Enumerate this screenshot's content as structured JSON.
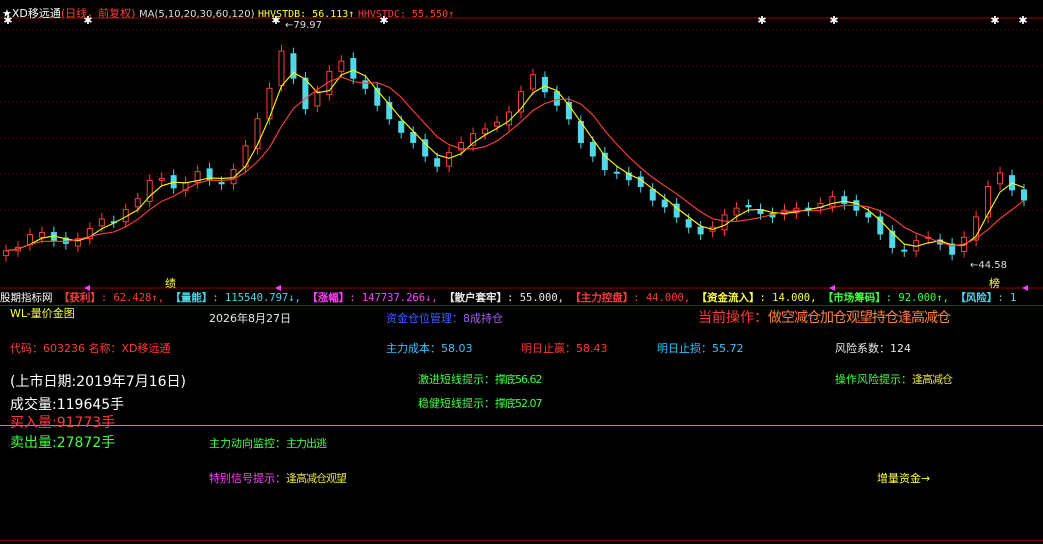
{
  "header": {
    "title_prefix": "★XD移远通",
    "period": "(日线，前复权)",
    "ma": "MA(5,10,20,30,60,120)",
    "hhv_tdb": "HHVSTDB: 56.113↑",
    "hhv_tdc": "HHVSTDC: 55.550↑"
  },
  "chart": {
    "high_label": "←79.97",
    "low_label": "←44.58",
    "marker_left": "绩",
    "marker_right": "榜"
  },
  "colors": {
    "bg": "#000000",
    "up": "#ff3c3c",
    "down": "#4fd8e8",
    "ma_yellow": "#ffff00",
    "ma_red": "#ff4040",
    "grid": "#800000",
    "divider": "#b8a000"
  },
  "chart_data": {
    "type": "candlestick",
    "y_high": 79.97,
    "y_low": 44.58,
    "series": [
      {
        "name": "close",
        "values": [
          46.5,
          47.0,
          48.9,
          49.2,
          48.0,
          47.6,
          48.3,
          49.8,
          51.2,
          50.8,
          52.6,
          54.2,
          56.9,
          57.2,
          55.8,
          56.6,
          58.2,
          57.0,
          56.4,
          58.5,
          62.0,
          66.0,
          70.5,
          76.0,
          72.0,
          67.5,
          70.0,
          73.0,
          74.5,
          72.0,
          70.5,
          68.0,
          66.0,
          64.0,
          62.5,
          60.5,
          59.0,
          61.0,
          62.5,
          63.8,
          64.5,
          65.5,
          67.0,
          70.0,
          72.5,
          70.0,
          68.0,
          66.0,
          62.5,
          60.5,
          58.5,
          58.0,
          57.0,
          56.0,
          54.0,
          53.0,
          51.5,
          50.0,
          49.0,
          50.0,
          51.8,
          52.8,
          53.0,
          52.0,
          51.5,
          52.5,
          52.8,
          52.5,
          53.5,
          54.5,
          53.5,
          52.5,
          51.5,
          49.0,
          47.0,
          46.5,
          48.0,
          48.5,
          47.5,
          46.0,
          48.5,
          51.5,
          56.0,
          58.0,
          55.5,
          54.0
        ]
      }
    ]
  },
  "strip": {
    "source": "股期指标网",
    "items": [
      {
        "name": "【获利】",
        "value": ": 62.428↑,",
        "color": "#ff3a3a"
      },
      {
        "name": "【量能】",
        "value": ": 115540.797↓,",
        "color": "#4fd8e8"
      },
      {
        "name": "【涨幅】",
        "value": ": 147737.266↓,",
        "color": "#ff40ff"
      },
      {
        "name": "【散户套牢】",
        "value": ": 55.000,",
        "color": "#e8e8e8"
      },
      {
        "name": "【主力控盘】",
        "value": ": 44.000,",
        "color": "#ff3a3a"
      },
      {
        "name": "【资金流入】",
        "value": ": 14.000,",
        "color": "#ffff40"
      },
      {
        "name": "【市场筹码】",
        "value": ": 92.000↑,",
        "color": "#40ff40"
      },
      {
        "name": "【风险】",
        "value": ": 1",
        "color": "#4fd8e8"
      }
    ]
  },
  "panel": {
    "title": "WL-量价金图",
    "date": "2026年8月27日",
    "position_label": "资金仓位管理：",
    "position_value": "8成持仓",
    "current_op_label": "当前操作：",
    "current_op_value": "做空减仓加仓观望持仓逢高减仓",
    "code_label": "代码：",
    "code_value": "603236",
    "name_label": " 名称：",
    "name_value": "XD移远通",
    "cost_label": "主力成本：",
    "cost_value": "58.03",
    "stoploss_label": "明日止赢：",
    "stoploss_value": "58.43",
    "tomorrow_stop_label": "明日止损：",
    "tomorrow_stop_value": "55.72",
    "risk_label": "风险系数：",
    "risk_value": "124",
    "listing": "(上市日期:2019年7月16日)",
    "aggressive_label": "激进短线提示：",
    "aggressive_value": "撑底56.62",
    "op_risk_label": "操作风险提示：",
    "op_risk_value": "逢高减仓",
    "volume": "成交量:119645手",
    "steady_label": "稳健短线提示：",
    "steady_value": "撑底52.07",
    "buy_volume": "买入量:91773手",
    "sell_volume": "卖出量:27872手",
    "main_flow_label": "主力动向监控：",
    "main_flow_value": "主力出逃",
    "special_label": "特别信号提示：",
    "special_value": "逢高减仓观望",
    "increase_funds": "增量资金→"
  }
}
